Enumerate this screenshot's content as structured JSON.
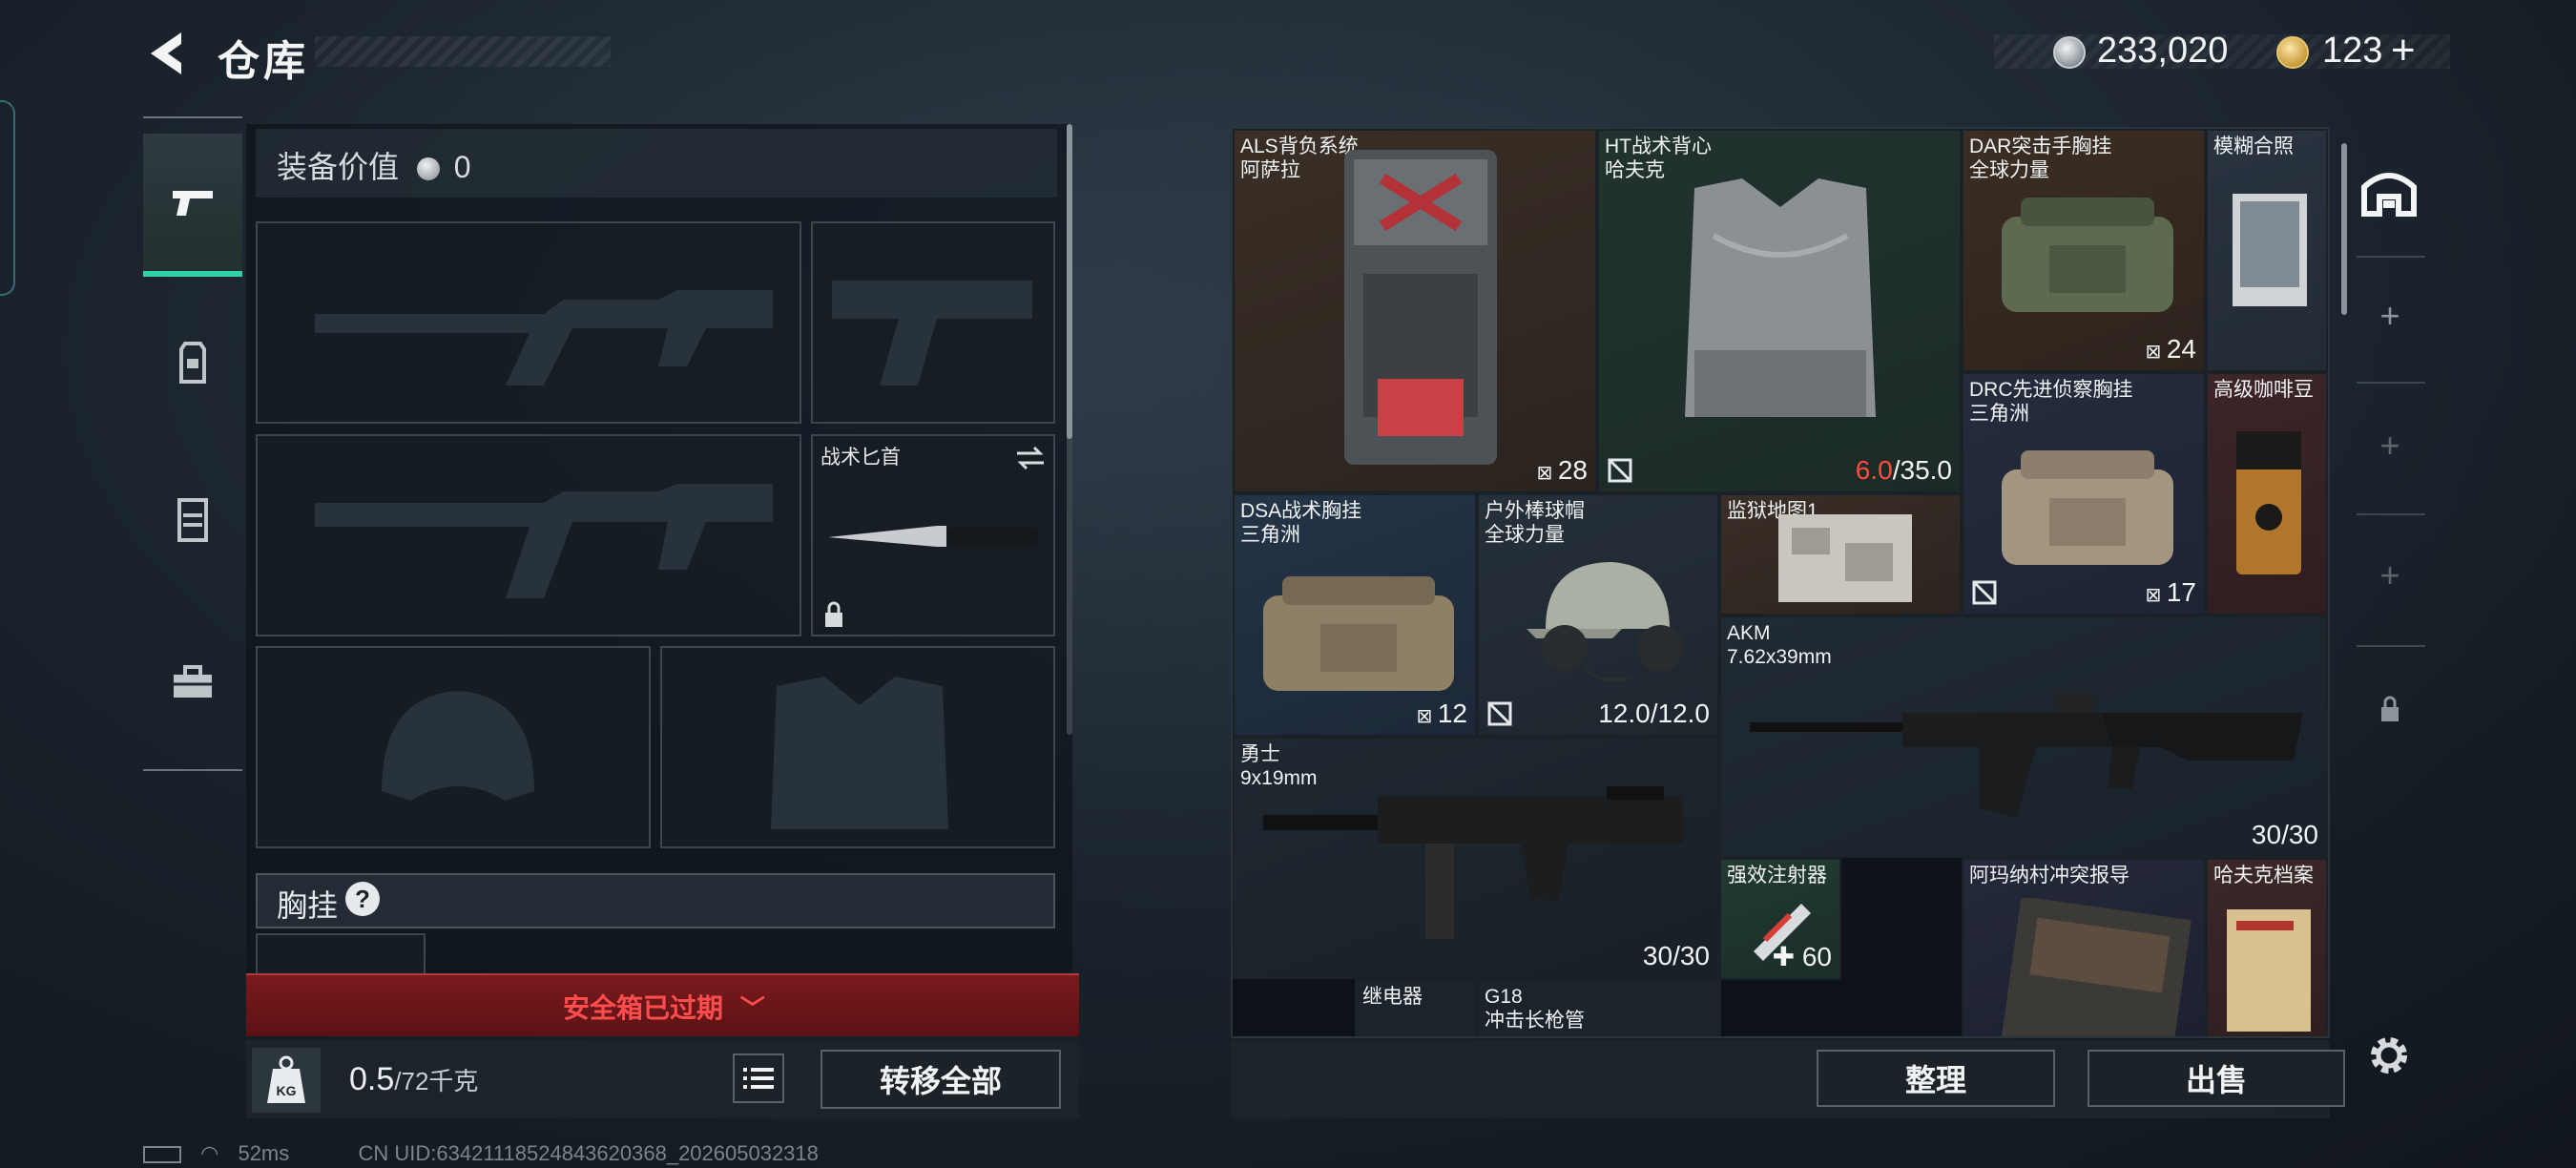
{
  "header": {
    "title": "仓库",
    "currency_silver": "233,020",
    "currency_gold": "123",
    "gold_plus": "+"
  },
  "tabs": [
    {
      "name": "pistol-icon",
      "active": true
    },
    {
      "name": "backpack-icon",
      "active": false
    },
    {
      "name": "vest-icon",
      "active": false
    },
    {
      "name": "toolbox-icon",
      "active": false
    }
  ],
  "equipment": {
    "value_label": "装备价值",
    "value": "0",
    "knife_label": "战术匕首",
    "chest_label": "胸挂",
    "help": "?"
  },
  "safe_box": {
    "expired": "安全箱已过期"
  },
  "weight": {
    "icon_label": "KG",
    "current": "0.5",
    "max": "/72千克"
  },
  "buttons": {
    "transfer_all": "转移全部",
    "sort": "整理",
    "sell": "出售"
  },
  "items": {
    "als": {
      "name": "ALS背负系统\n阿萨拉",
      "count": "28"
    },
    "ht": {
      "name": "HT战术背心\n哈夫克",
      "dura_cur": "6.0",
      "dura_max": "/35.0"
    },
    "dar": {
      "name": "DAR突击手胸挂\n全球力量",
      "count": "24"
    },
    "blur": {
      "name": "模糊合照"
    },
    "drc": {
      "name": "DRC先进侦察胸挂\n三角洲",
      "count": "17"
    },
    "coffee": {
      "name": "高级咖啡豆"
    },
    "dsa": {
      "name": "DSA战术胸挂\n三角洲",
      "count": "12"
    },
    "cap": {
      "name": "户外棒球帽\n全球力量",
      "dura": "12.0/12.0"
    },
    "map": {
      "name": "监狱地图1"
    },
    "akm": {
      "name": "AKM\n7.62x39mm",
      "ammo": "30/30"
    },
    "warrior": {
      "name": "勇士\n9x19mm",
      "ammo": "30/30"
    },
    "injector": {
      "name": "强效注射器",
      "count": "60"
    },
    "amana": {
      "name": "阿玛纳村冲突报导"
    },
    "haavk": {
      "name": "哈夫克档案"
    },
    "relay": {
      "name": "继电器"
    },
    "g18": {
      "name": "G18\n冲击长枪管"
    }
  },
  "status_bar": {
    "ping": "52ms",
    "uid": "CN UID:63421118524843620368_202605032318"
  },
  "colors": {
    "accent": "#2fd1a8",
    "danger": "#ff4d4d",
    "durability_low": "#ff4b3e"
  }
}
